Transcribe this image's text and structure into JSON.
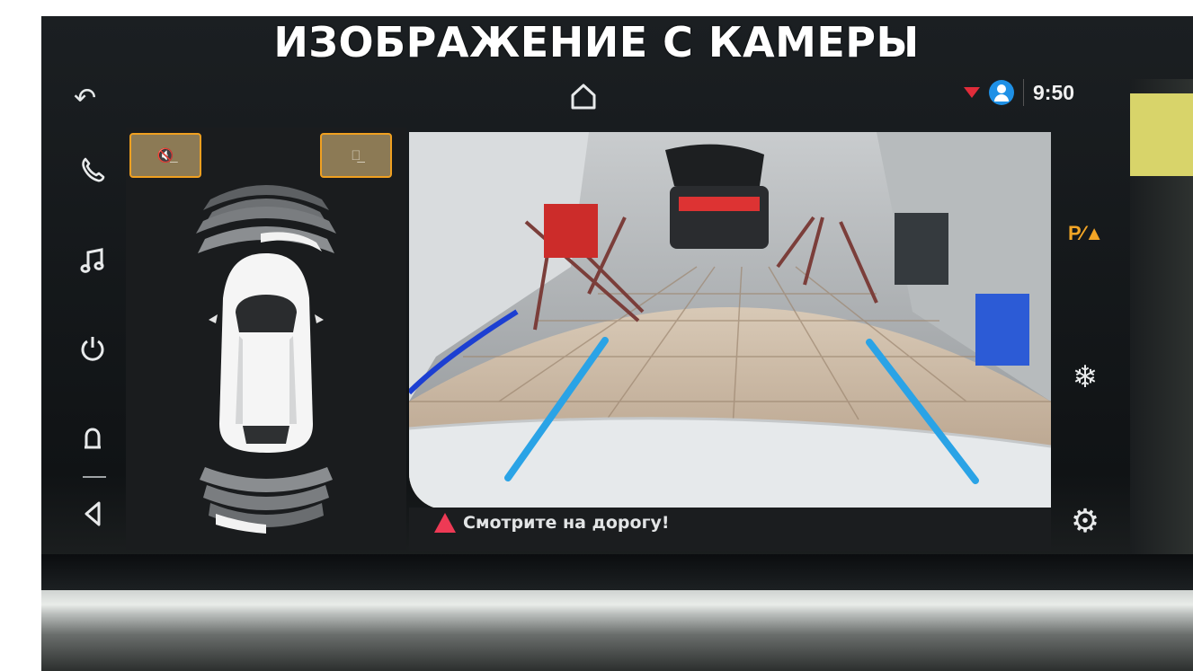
{
  "headline": "ИЗОБРАЖЕНИЕ С КАМЕРЫ",
  "status_bar": {
    "time": "9:50",
    "connection_color": "#e02c3a",
    "profile_color": "#1e90e6"
  },
  "left_sidebar": {
    "items": [
      {
        "icon": "phone-icon"
      },
      {
        "icon": "music-note-icon"
      },
      {
        "icon": "power-icon"
      },
      {
        "icon": "notification-bell-icon"
      },
      {
        "icon": "volume-icon"
      }
    ]
  },
  "park_panel": {
    "buttons": [
      {
        "icon": "mute-sensor-sound-icon",
        "label": "🔇̲"
      },
      {
        "icon": "auto-activation-icon",
        "label": "Ⓐ̲"
      }
    ],
    "accent_color": "#f0a020"
  },
  "camera": {
    "warning_text": "Смотрите на дорогу!",
    "guide_line_color": "#2aa3e6"
  },
  "right_sidebar": {
    "park_assist_label": "P⁄▲",
    "park_assist_color": "#f2a526"
  }
}
